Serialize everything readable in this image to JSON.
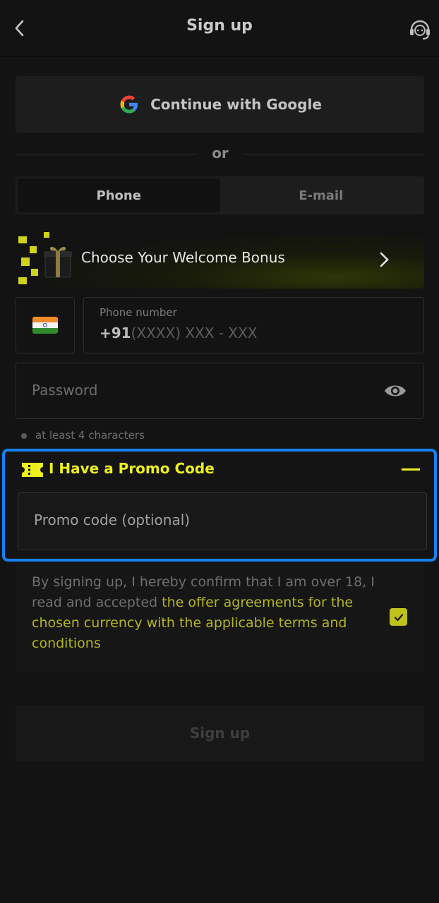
{
  "header": {
    "title": "Sign up",
    "back_icon": "chevron-left-icon",
    "support_icon": "headset-icon"
  },
  "google": {
    "label": "Continue with Google",
    "icon": "google-icon"
  },
  "divider": {
    "text": "or"
  },
  "tabs": [
    {
      "label": "Phone",
      "active": true
    },
    {
      "label": "E-mail",
      "active": false
    }
  ],
  "bonus": {
    "label": "Choose Your Welcome Bonus",
    "icon": "gift-icon",
    "chevron_icon": "chevron-right-icon"
  },
  "phone": {
    "flag_icon": "india-flag-icon",
    "label": "Phone number",
    "prefix": "+91",
    "placeholder": "(XXXX) XXX - XXX"
  },
  "password": {
    "placeholder": "Password",
    "eye_icon": "eye-icon",
    "hint": "at least 4 characters"
  },
  "promo": {
    "title": "I Have a Promo Code",
    "icon": "ticket-icon",
    "collapse_icon": "minus-icon",
    "placeholder": "Promo code (optional)"
  },
  "terms": {
    "text_part1": "By signing up, I hereby confirm that I am over 18, I read and accepted ",
    "link_text": "the offer agreements for the chosen currency with the applicable terms and conditions",
    "checked": true
  },
  "signup_button": {
    "label": "Sign up"
  },
  "colors": {
    "accent": "#ecf01d",
    "focus_border": "#1683f2",
    "background": "#131313"
  }
}
